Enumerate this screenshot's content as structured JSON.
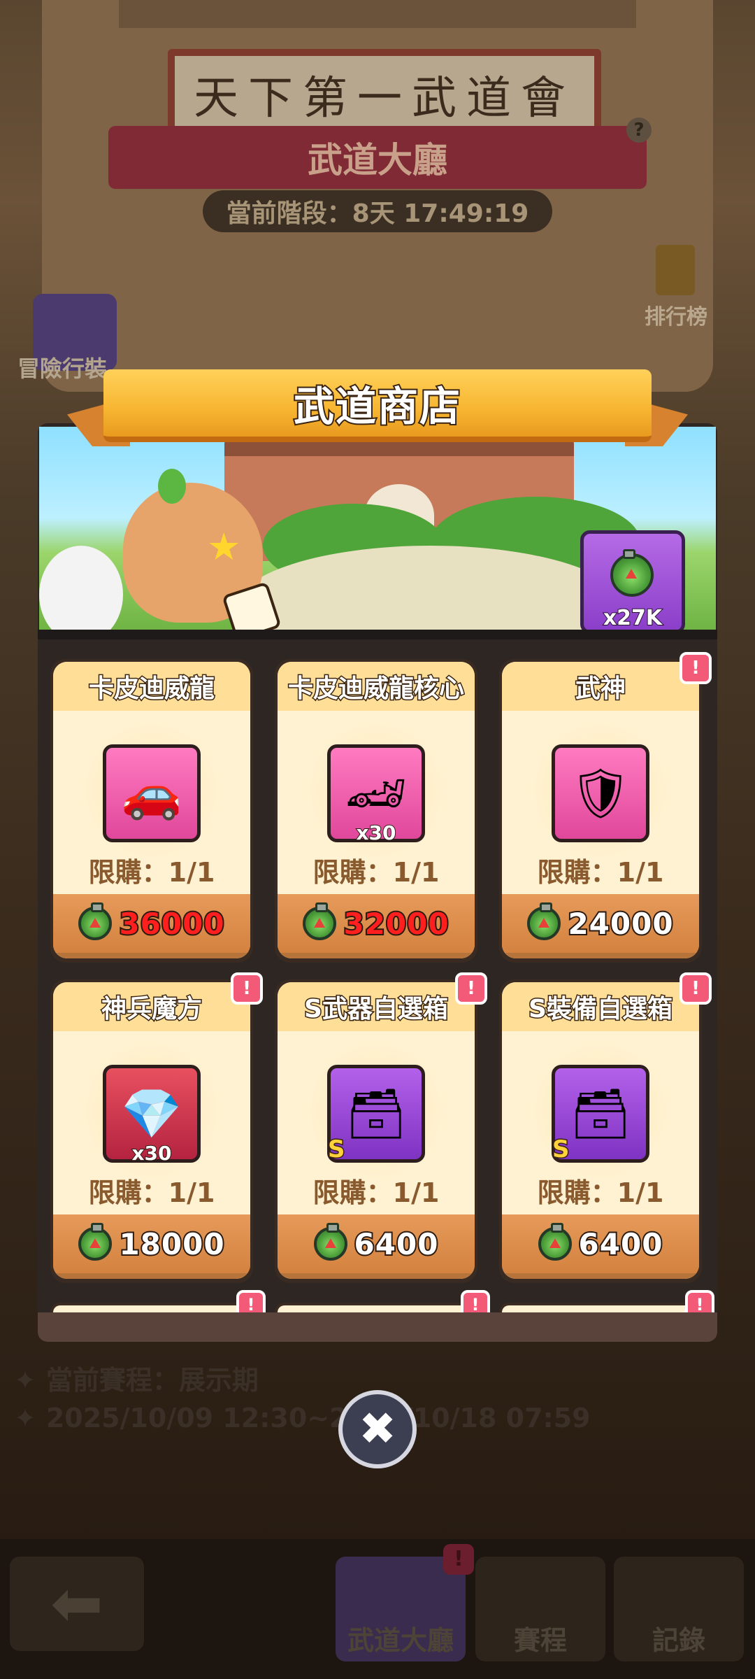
{
  "background": {
    "signboard": "天下第一武道會",
    "hall_title": "武道大廳",
    "timer_text": "當前階段：8天 17:49:19",
    "help_glyph": "?",
    "ranking_label": "排行榜",
    "adventure_label": "冒險行裝",
    "schedule_label": "當前賽程：展示期",
    "schedule_range": "2025/10/09 12:30~2025/10/18 07:59",
    "bullet_glyph": "✦",
    "back_glyph": "⬅",
    "nav": [
      {
        "label": "武道大廳",
        "badge": "!"
      },
      {
        "label": "賽程"
      },
      {
        "label": "記錄"
      }
    ]
  },
  "shop": {
    "title": "武道商店",
    "currency_amount": "x27K",
    "limit_prefix": "限購：",
    "items": [
      {
        "name": "卡皮迪威龍",
        "limit": "1/1",
        "price": "36000",
        "price_insufficient": true,
        "art": "🚗",
        "color": "pink",
        "qty": "",
        "grade": "",
        "alert": false
      },
      {
        "name": "卡皮迪威龍核心",
        "limit": "1/1",
        "price": "32000",
        "price_insufficient": true,
        "art": "🏎",
        "color": "pink",
        "qty": "x30",
        "grade": "",
        "alert": false
      },
      {
        "name": "武神",
        "limit": "1/1",
        "price": "24000",
        "price_insufficient": false,
        "art": "🛡",
        "color": "pink",
        "qty": "",
        "grade": "",
        "alert": true
      },
      {
        "name": "神兵魔方",
        "limit": "1/1",
        "price": "18000",
        "price_insufficient": false,
        "art": "💎",
        "color": "red",
        "qty": "x30",
        "grade": "",
        "alert": true
      },
      {
        "name": "S武器自選箱",
        "limit": "1/1",
        "price": "6400",
        "price_insufficient": false,
        "art": "🗃",
        "color": "purple",
        "qty": "",
        "grade": "S",
        "alert": true
      },
      {
        "name": "S裝備自選箱",
        "limit": "1/1",
        "price": "6400",
        "price_insufficient": false,
        "art": "🗃",
        "color": "purple",
        "qty": "",
        "grade": "S",
        "alert": true
      }
    ],
    "alert_glyph": "!",
    "close_glyph": "✖"
  },
  "colors": {
    "price_red": "#ff1f1f",
    "ribbon_gold": "#f7b531",
    "card_cream": "#fff2d2",
    "alert_pink": "#f25a78"
  }
}
